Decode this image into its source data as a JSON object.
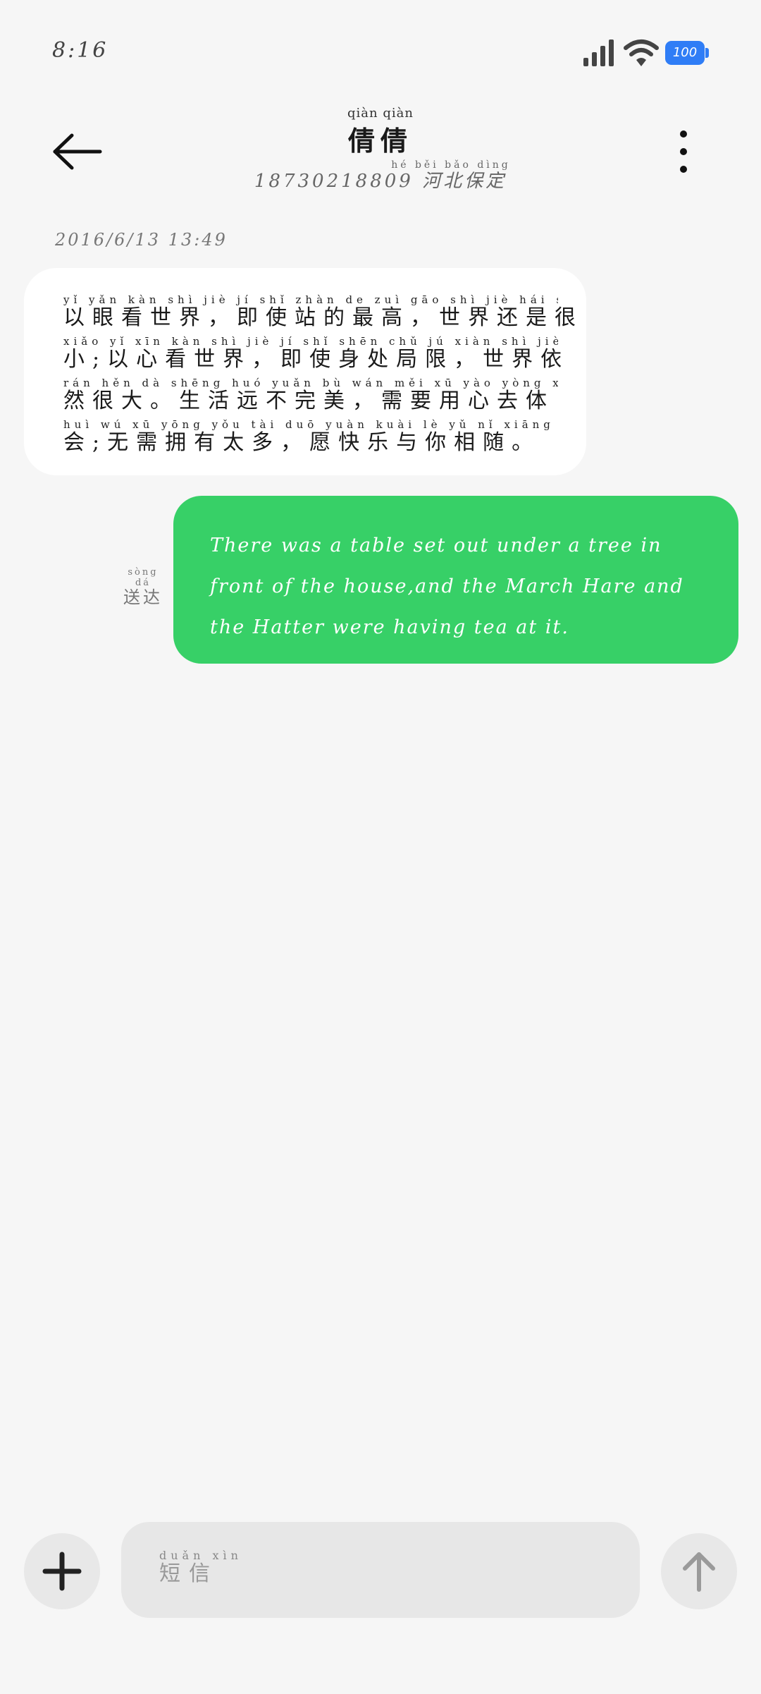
{
  "status_bar": {
    "time": "8:16",
    "battery": "100"
  },
  "header": {
    "contact_name_pinyin": "qiàn qiàn",
    "contact_name": "倩倩",
    "phone": "18730218809",
    "location_pinyin": "hé běi bǎo dìng",
    "location": "河北保定"
  },
  "conversation": {
    "timestamp": "2016/6/13 13:49",
    "incoming_message": {
      "lines": [
        {
          "pinyin": "yǐ yǎn kàn shì jiè   jí shǐ zhàn de zuì gāo   shì jiè hái shì hěn",
          "text": "以眼看世界，即使站的最高，世界还是很"
        },
        {
          "pinyin": "xiǎo yǐ xīn kàn shì jiè   jí shǐ shēn chǔ jú xiàn   shì jiè yī",
          "text": "小;以心看世界，即使身处局限，世界依"
        },
        {
          "pinyin": "rán hěn dà   shēng huó yuǎn bù wán měi   xū yào yòng xīn qù tǐ",
          "text": "然很大。生活远不完美，需要用心去体"
        },
        {
          "pinyin": "huì wú xū yōng yǒu tài duō   yuàn kuài lè yǔ nǐ xiāng suí",
          "text": "会;无需拥有太多，愿快乐与你相随。"
        }
      ]
    },
    "outgoing_message": {
      "text": "There was a table set out under a tree in front of the house,and the March Hare and the Hatter were having tea at it.",
      "status_pinyin": "sòng dá",
      "status": "送达"
    }
  },
  "composer": {
    "placeholder_pinyin": "duǎn xìn",
    "placeholder": "短信"
  },
  "icons": {
    "back": "arrow-left-icon",
    "more": "more-vertical-icon",
    "add": "plus-icon",
    "send": "arrow-up-icon"
  },
  "colors": {
    "outgoing_bubble": "#37d067",
    "incoming_bubble": "#ffffff",
    "background": "#f6f6f6",
    "battery": "#2f7df6"
  }
}
